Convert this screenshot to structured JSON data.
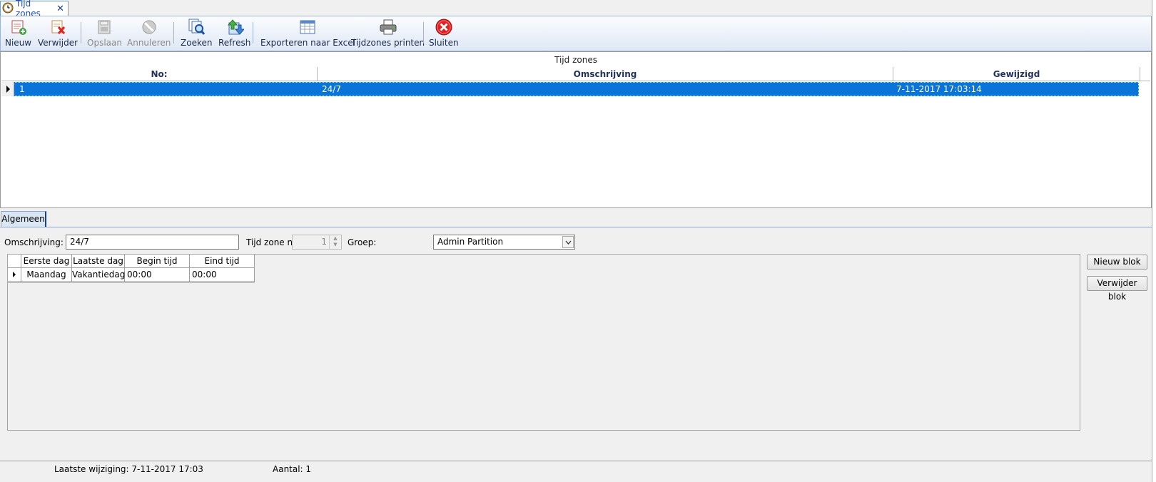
{
  "tab": {
    "title": "Tijd zones",
    "close": "✕"
  },
  "toolbar": {
    "buttons": [
      {
        "label": "Nieuw",
        "icon": "new-record-icon",
        "enabled": true
      },
      {
        "label": "Verwijder",
        "icon": "delete-record-icon",
        "enabled": true
      },
      {
        "label": "Opslaan",
        "icon": "save-icon",
        "enabled": false
      },
      {
        "label": "Annuleren",
        "icon": "cancel-icon",
        "enabled": false
      },
      {
        "label": "Zoeken",
        "icon": "search-icon",
        "enabled": true
      },
      {
        "label": "Refresh",
        "icon": "refresh-icon",
        "enabled": true
      },
      {
        "label": "Exporteren naar Excel",
        "icon": "excel-export-icon",
        "enabled": true
      },
      {
        "label": "Tijdzones printen",
        "icon": "printer-icon",
        "enabled": true
      },
      {
        "label": "Sluiten",
        "icon": "close-circle-icon",
        "enabled": true
      }
    ]
  },
  "grid": {
    "caption": "Tijd zones",
    "columns": [
      "No:",
      "Omschrijving",
      "Gewijzigd"
    ],
    "rows": [
      {
        "no": "1",
        "omschrijving": "24/7",
        "gewijzigd": "7-11-2017 17:03:14"
      }
    ]
  },
  "detail": {
    "tab_label": "Algemeen",
    "omschrijving_label": "Omschrijving:",
    "omschrijving_value": "24/7",
    "tijdzone_label": "Tijd zone nr:",
    "tijdzone_value": "1",
    "groep_label": "Groep:",
    "groep_value": "Admin Partition",
    "blocks": {
      "columns": [
        "Eerste dag",
        "Laatste dag",
        "Begin tijd",
        "Eind tijd"
      ],
      "rows": [
        {
          "eerste": "Maandag",
          "laatste": "Vakantiedag",
          "begin": "00:00",
          "eind": "00:00"
        }
      ]
    },
    "new_block_label": "Nieuw blok",
    "delete_block_label": "Verwijder blok"
  },
  "status": {
    "last_change": "Laatste wijziging: 7-11-2017 17:03",
    "count": "Aantal: 1"
  },
  "colors": {
    "selection": "#0a74d9",
    "tab_text": "#1b4fbb",
    "close_red": "#e02020"
  }
}
